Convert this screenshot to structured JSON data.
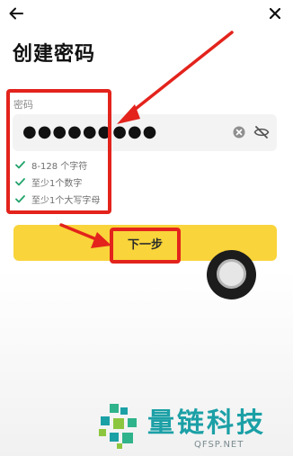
{
  "header": {
    "back_icon": "arrow-left-icon",
    "close_icon": "close-icon",
    "title": "创建密码"
  },
  "password": {
    "label": "密码",
    "masked_value": "●●●●●●●●●",
    "clear_icon": "clear-circle-icon",
    "visibility_icon": "eye-off-icon"
  },
  "rules": [
    {
      "text": "8-128 个字符",
      "icon": "check-icon",
      "satisfied": true
    },
    {
      "text": "至少1个数字",
      "icon": "check-icon",
      "satisfied": true
    },
    {
      "text": "至少1个大写字母",
      "icon": "check-icon",
      "satisfied": true
    }
  ],
  "next_button": {
    "label": "下一步"
  },
  "watermark": {
    "text": "量链科技",
    "url": "QFSP.NET"
  },
  "colors": {
    "accent_yellow": "#f9d43a",
    "check_green": "#22a36b",
    "annotation_red": "#e3231c",
    "watermark_teal": "#1ba0a6"
  }
}
